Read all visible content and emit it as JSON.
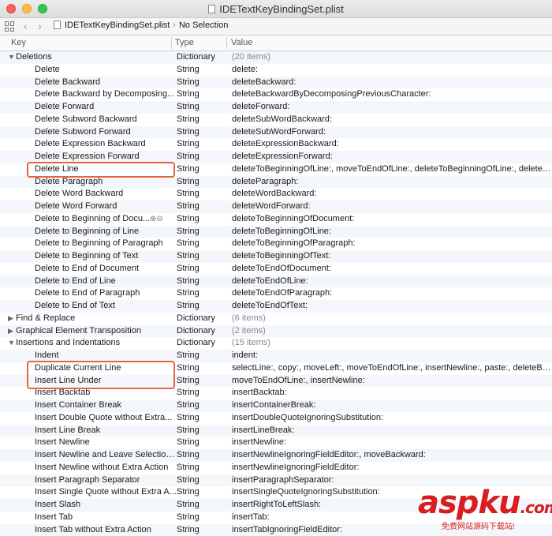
{
  "window": {
    "title": "IDETextKeyBindingSet.plist"
  },
  "jumpbar": {
    "file": "IDETextKeyBindingSet.plist",
    "selection": "No Selection"
  },
  "columns": {
    "key": "Key",
    "type": "Type",
    "value": "Value"
  },
  "rows": [
    {
      "kind": "section",
      "expanded": true,
      "key": "Deletions",
      "type": "Dictionary",
      "value": "(20 items)"
    },
    {
      "kind": "item",
      "key": "Delete",
      "type": "String",
      "value": "delete:"
    },
    {
      "kind": "item",
      "key": "Delete Backward",
      "type": "String",
      "value": "deleteBackward:"
    },
    {
      "kind": "item",
      "key": "Delete Backward by Decomposing...",
      "type": "String",
      "value": "deleteBackwardByDecomposingPreviousCharacter:"
    },
    {
      "kind": "item",
      "key": "Delete Forward",
      "type": "String",
      "value": "deleteForward:"
    },
    {
      "kind": "item",
      "key": "Delete Subword Backward",
      "type": "String",
      "value": "deleteSubWordBackward:"
    },
    {
      "kind": "item",
      "key": "Delete Subword Forward",
      "type": "String",
      "value": "deleteSubWordForward:"
    },
    {
      "kind": "item",
      "key": "Delete Expression Backward",
      "type": "String",
      "value": "deleteExpressionBackward:"
    },
    {
      "kind": "item",
      "key": "Delete Expression Forward",
      "type": "String",
      "value": "deleteExpressionForward:"
    },
    {
      "kind": "item",
      "key": "Delete Line",
      "type": "String",
      "value": "deleteToBeginningOfLine:, moveToEndOfLine:, deleteToBeginningOfLine:, deleteBackwar"
    },
    {
      "kind": "item",
      "key": "Delete Paragraph",
      "type": "String",
      "value": "deleteParagraph:"
    },
    {
      "kind": "item",
      "key": "Delete Word Backward",
      "type": "String",
      "value": "deleteWordBackward:"
    },
    {
      "kind": "item",
      "key": "Delete Word Forward",
      "type": "String",
      "value": "deleteWordForward:"
    },
    {
      "kind": "item",
      "key": "Delete to Beginning of Docu...",
      "type": "String",
      "value": "deleteToBeginningOfDocument:",
      "controls": true
    },
    {
      "kind": "item",
      "key": "Delete to Beginning of Line",
      "type": "String",
      "value": "deleteToBeginningOfLine:"
    },
    {
      "kind": "item",
      "key": "Delete to Beginning of Paragraph",
      "type": "String",
      "value": "deleteToBeginningOfParagraph:"
    },
    {
      "kind": "item",
      "key": "Delete to Beginning of Text",
      "type": "String",
      "value": "deleteToBeginningOfText:"
    },
    {
      "kind": "item",
      "key": "Delete to End of Document",
      "type": "String",
      "value": "deleteToEndOfDocument:"
    },
    {
      "kind": "item",
      "key": "Delete to End of Line",
      "type": "String",
      "value": "deleteToEndOfLine:"
    },
    {
      "kind": "item",
      "key": "Delete to End of Paragraph",
      "type": "String",
      "value": "deleteToEndOfParagraph:"
    },
    {
      "kind": "item",
      "key": "Delete to End of Text",
      "type": "String",
      "value": "deleteToEndOfText:"
    },
    {
      "kind": "section",
      "expanded": false,
      "key": "Find & Replace",
      "type": "Dictionary",
      "value": "(6 items)"
    },
    {
      "kind": "section",
      "expanded": false,
      "key": "Graphical Element Transposition",
      "type": "Dictionary",
      "value": "(2 items)"
    },
    {
      "kind": "section",
      "expanded": true,
      "key": "Insertions and Indentations",
      "type": "Dictionary",
      "value": "(15 items)"
    },
    {
      "kind": "item",
      "key": "Indent",
      "type": "String",
      "value": "indent:"
    },
    {
      "kind": "item",
      "key": "Duplicate Current Line",
      "type": "String",
      "value": "selectLine:, copy:, moveLeft:, moveToEndOfLine:, insertNewline:, paste:, deleteBackward"
    },
    {
      "kind": "item",
      "key": "Insert Line Under",
      "type": "String",
      "value": "moveToEndOfLine:, insertNewline:"
    },
    {
      "kind": "item",
      "key": "Insert Backtab",
      "type": "String",
      "value": "insertBacktab:"
    },
    {
      "kind": "item",
      "key": "Insert Container Break",
      "type": "String",
      "value": "insertContainerBreak:"
    },
    {
      "kind": "item",
      "key": "Insert Double Quote without Extra...",
      "type": "String",
      "value": "insertDoubleQuoteIgnoringSubstitution:"
    },
    {
      "kind": "item",
      "key": "Insert Line Break",
      "type": "String",
      "value": "insertLineBreak:"
    },
    {
      "kind": "item",
      "key": "Insert Newline",
      "type": "String",
      "value": "insertNewline:"
    },
    {
      "kind": "item",
      "key": "Insert Newline and Leave Selection...",
      "type": "String",
      "value": "insertNewlineIgnoringFieldEditor:, moveBackward:"
    },
    {
      "kind": "item",
      "key": "Insert Newline without Extra Action",
      "type": "String",
      "value": "insertNewlineIgnoringFieldEditor:"
    },
    {
      "kind": "item",
      "key": "Insert Paragraph Separator",
      "type": "String",
      "value": "insertParagraphSeparator:"
    },
    {
      "kind": "item",
      "key": "Insert Single Quote without Extra A...",
      "type": "String",
      "value": "insertSingleQuoteIgnoringSubstitution:"
    },
    {
      "kind": "item",
      "key": "Insert Slash",
      "type": "String",
      "value": "insertRightToLeftSlash:"
    },
    {
      "kind": "item",
      "key": "Insert Tab",
      "type": "String",
      "value": "insertTab:"
    },
    {
      "kind": "item",
      "key": "Insert Tab without Extra Action",
      "type": "String",
      "value": "insertTabIgnoringFieldEditor:"
    }
  ],
  "highlights": [
    {
      "label": "delete-line",
      "rows": [
        9,
        9
      ]
    },
    {
      "label": "duplicate-and-insert-line",
      "rows": [
        25,
        26
      ]
    }
  ],
  "watermark": {
    "brand": "aspku",
    "suffix": ".com",
    "tagline": "免费网站源码下载站!"
  },
  "colors": {
    "highlight": "#e8643c",
    "watermark": "#d81e1e"
  }
}
